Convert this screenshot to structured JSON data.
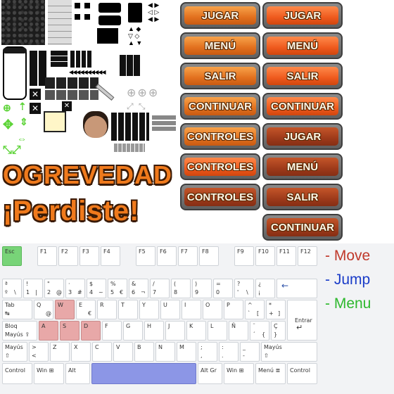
{
  "sprites": {
    "title": "OGREVEDAD",
    "subtitle": "¡Perdiste!"
  },
  "buttons_left": [
    {
      "label": "JUGAR",
      "style": "orange"
    },
    {
      "label": "MENÚ",
      "style": "orange"
    },
    {
      "label": "SALIR",
      "style": "orange"
    },
    {
      "label": "CONTINUAR",
      "style": "orange"
    },
    {
      "label": "CONTROLES",
      "style": "orange"
    },
    {
      "label": "CONTROLES",
      "style": "bright"
    },
    {
      "label": "CONTROLES",
      "style": "brown"
    }
  ],
  "buttons_right": [
    {
      "label": "JUGAR",
      "style": "bright"
    },
    {
      "label": "MENÚ",
      "style": "bright"
    },
    {
      "label": "SALIR",
      "style": "bright"
    },
    {
      "label": "CONTINUAR",
      "style": "bright"
    },
    {
      "label": "JUGAR",
      "style": "brown"
    },
    {
      "label": "MENÚ",
      "style": "brown"
    },
    {
      "label": "SALIR",
      "style": "brown"
    },
    {
      "label": "CONTINUAR",
      "style": "brown"
    }
  ],
  "legend": {
    "move": "- Move",
    "jump": "- Jump",
    "menu": "- Menu"
  },
  "colors": {
    "move": "#c0392b",
    "jump": "#1a3cc8",
    "menu": "#2eb82e",
    "title_orange": "#f07a1c"
  },
  "keyboard": {
    "fn_row": [
      "Esc",
      "F1",
      "F2",
      "F3",
      "F4",
      "F5",
      "F6",
      "F7",
      "F8",
      "F9",
      "F10",
      "F11",
      "F12"
    ],
    "num_row": [
      {
        "top": "ª",
        "bottom": "º",
        "extra": "\\"
      },
      {
        "top": "!",
        "bottom": "1",
        "extra": "|"
      },
      {
        "top": "\"",
        "bottom": "2",
        "extra": "@"
      },
      {
        "top": "·",
        "bottom": "3",
        "extra": "#"
      },
      {
        "top": "$",
        "bottom": "4",
        "extra": "~"
      },
      {
        "top": "%",
        "bottom": "5",
        "extra": "€"
      },
      {
        "top": "&",
        "bottom": "6",
        "extra": "¬"
      },
      {
        "top": "/",
        "bottom": "7",
        "extra": ""
      },
      {
        "top": "(",
        "bottom": "8",
        "extra": ""
      },
      {
        "top": ")",
        "bottom": "9",
        "extra": ""
      },
      {
        "top": "=",
        "bottom": "0",
        "extra": ""
      },
      {
        "top": "?",
        "bottom": "'",
        "extra": "\\"
      },
      {
        "top": "¿",
        "bottom": "¡",
        "extra": ""
      },
      {
        "top": "←",
        "bottom": "",
        "extra": ""
      }
    ],
    "tab": "Tab",
    "tab_arrows": "↹",
    "q_row": [
      "Q",
      "W",
      "E",
      "R",
      "T",
      "Y",
      "U",
      "I",
      "O",
      "P"
    ],
    "q_row_extras": {
      "Q": "@",
      "E": "€"
    },
    "bracket_top": "^",
    "bracket_bottom": "`",
    "bracket_extra": "[",
    "plus_top": "*",
    "plus_bottom": "+",
    "plus_extra": "]",
    "enter": "Entrar",
    "enter_arrow": "↵",
    "caps_1": "Bloq",
    "caps_2": "Mayús ⇪",
    "a_row": [
      "A",
      "S",
      "D",
      "F",
      "G",
      "H",
      "J",
      "K",
      "L",
      "Ñ"
    ],
    "brace_top": "¨",
    "brace_bottom": "´",
    "brace_extra": "{",
    "cedilla_top": "Ç",
    "cedilla_extra": "}",
    "shift": "Mayús",
    "shift_arrow": "⇧",
    "lt_top": ">",
    "lt_bottom": "<",
    "z_row": [
      "Z",
      "X",
      "C",
      "V",
      "B",
      "N",
      "M"
    ],
    "comma_top": ";",
    "comma_bottom": ",",
    "dot_top": ":",
    "dot_bottom": ".",
    "dash_top": "_",
    "dash_bottom": "-",
    "ctrl": "Control",
    "win": "Win ⊞",
    "alt": "Alt",
    "altgr": "Alt Gr",
    "menu": "Menú ≣"
  }
}
